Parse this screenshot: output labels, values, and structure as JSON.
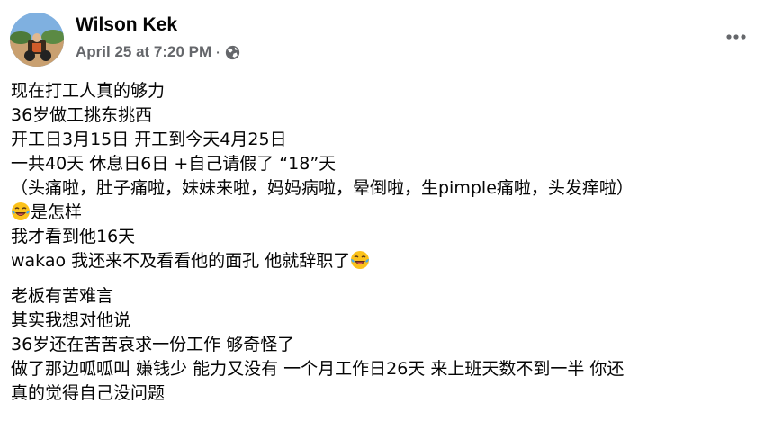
{
  "post": {
    "author": "Wilson Kek",
    "timestamp": "April 25 at 7:20 PM",
    "separator": "·",
    "audience_icon": "globe-icon",
    "menu_icon": "more-options-icon",
    "paragraph_1": [
      "现在打工人真的够力",
      "36岁做工挑东挑西",
      "开工日3月15日 开工到今天4月25日",
      "一共40天 休息日6日 +自己请假了 “18”天",
      "（头痛啦，肚子痛啦，妹妹来啦，妈妈病啦，晕倒啦，生pimple痛啦，头发痒啦）",
      "是怎样",
      "我才看到他16天",
      "wakao 我还来不及看看他的面孔 他就辞职了"
    ],
    "paragraph_2": [
      "老板有苦难言",
      "其实我想对他说",
      "36岁还在苦苦哀求一份工作 够奇怪了",
      "做了那边呱呱叫 嫌钱少 能力又没有 一个月工作日26天 来上班天数不到一半 你还",
      "真的觉得自己没问题"
    ],
    "emoji_icon": "laughing-tears-emoji"
  },
  "colors": {
    "text": "#050505",
    "secondary_text": "#65676b",
    "background": "#ffffff"
  }
}
